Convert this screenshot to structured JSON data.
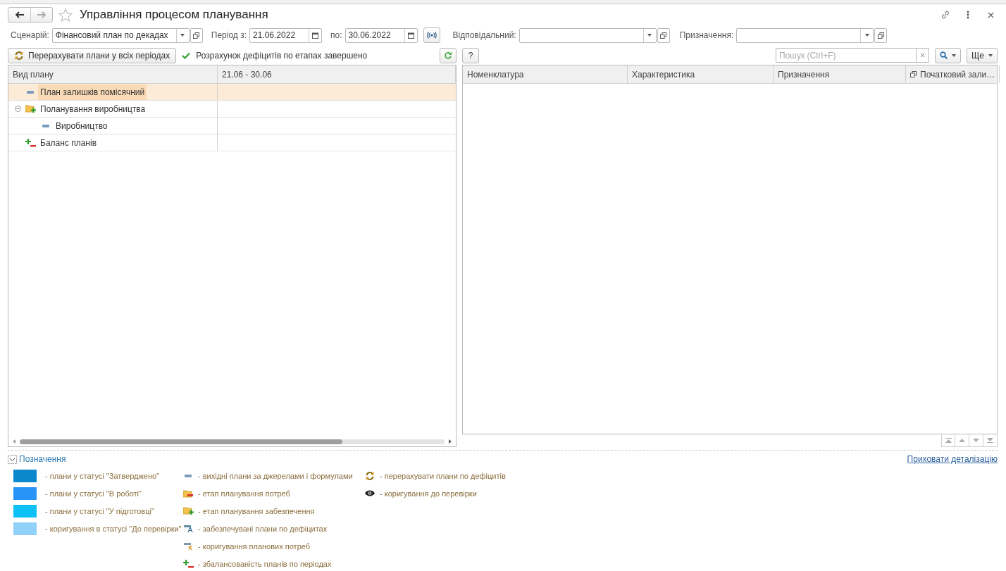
{
  "window": {
    "title": "Управління процесом планування"
  },
  "filters": [
    {
      "kind": "combo",
      "label": "Сценарій:",
      "value": "Фінансовий план по декадах"
    },
    {
      "kind": "date",
      "label": "Період з:",
      "value": "21.06.2022"
    },
    {
      "kind": "date",
      "label": "по:",
      "value": "30.06.2022"
    },
    {
      "kind": "toggle"
    },
    {
      "kind": "combo_wide",
      "label": "Відповідальний:"
    },
    {
      "kind": "combo_wide",
      "label": "Призначення:"
    }
  ],
  "toolbar": {
    "recalc_button": "Перерахувати плани у всіх періодах",
    "status": "Розрахунок дефіцитів по етапах завершено",
    "help_button": "?",
    "search": {
      "placeholder": "Пошук (Ctrl+F)"
    },
    "more_button": "Ще"
  },
  "tree": {
    "columns": [
      "Вид плану",
      "21.06 - 30.06"
    ],
    "rows": [
      {
        "kind": "output",
        "label": "План залишків помісячний",
        "selected": true
      },
      {
        "kind": "supply_stage",
        "label": "Поланування виробництва",
        "selected": false,
        "expanded": true,
        "children": [
          {
            "kind": "output",
            "label": "Виробництво",
            "selected": false
          }
        ]
      },
      {
        "kind": "balance",
        "label": "Баланс планів",
        "selected": false
      }
    ]
  },
  "grid": {
    "columns": [
      {
        "label": "Номенклатура"
      },
      {
        "label": "Характеристика"
      },
      {
        "label": "Призначення"
      },
      {
        "label": "Початковий зали…",
        "icon": true
      }
    ]
  },
  "legend": {
    "title": "Позначення",
    "hide_link": "Приховати деталізацію",
    "columns": [
      [
        {
          "kind": "swatch",
          "color": "#0a88cc",
          "label": "- плани у статусі \"Затверджено\""
        },
        {
          "kind": "swatch",
          "color": "#2894f7",
          "label": "- плани у статусі \"В роботі\""
        },
        {
          "kind": "swatch",
          "color": "#0dc0f5",
          "label": "- плани у статусі \"У підготовці\""
        },
        {
          "kind": "swatch",
          "color": "#8fd1f8",
          "label": "- коригування в статусі \"До перевірки\""
        }
      ],
      [
        {
          "kind": "output",
          "label": "- вихідні плани за джерелами і формулами"
        },
        {
          "kind": "needs_stage",
          "label": "- етап планування потреб"
        },
        {
          "kind": "supply_stage",
          "label": "- етап планування забезпечення"
        },
        {
          "kind": "supplied",
          "label": "- забезпечувані плани по дефіцитах"
        },
        {
          "kind": "correction",
          "label": "- коригування планових потреб"
        },
        {
          "kind": "balance",
          "label": "- збалансованість планів по періодах"
        }
      ],
      [
        {
          "kind": "recalc",
          "label": "- перерахувати плани по дефіцитів"
        },
        {
          "kind": "eye",
          "label": "- коригування до перевірки"
        }
      ]
    ]
  }
}
